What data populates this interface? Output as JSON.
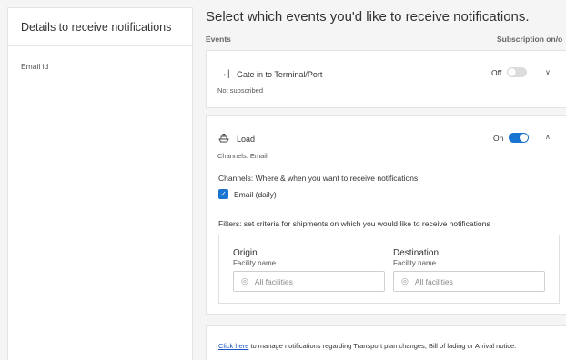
{
  "sidebar": {
    "title": "Details to receive notifications",
    "email_label": "Email id"
  },
  "main": {
    "title": "Select which events you'd like to receive notifications.",
    "col_events": "Events",
    "col_subscription": "Subscription on/o"
  },
  "events": [
    {
      "icon": "gate-in-icon",
      "name": "Gate in to Terminal/Port",
      "status": "Not subscribed",
      "toggle_label": "Off",
      "toggle_on": false,
      "expanded": false
    },
    {
      "icon": "ship-load-icon",
      "name": "Load",
      "status": "Channels: Email",
      "toggle_label": "On",
      "toggle_on": true,
      "expanded": true,
      "channels_heading": "Channels: Where & when you want to receive notifications",
      "channel_option": "Email (daily)",
      "channel_checked": true,
      "filters_heading": "Filters: set criteria for shipments on which you would like to receive notifications",
      "origin_title": "Origin",
      "origin_sub": "Facility name",
      "origin_placeholder": "All facilities",
      "destination_title": "Destination",
      "destination_sub": "Facility name",
      "destination_placeholder": "All facilities"
    }
  ],
  "footer": {
    "link_text": "Click here",
    "rest_text": " to manage notifications regarding Transport plan changes, Bill of lading or Arrival notice."
  },
  "colors": {
    "accent": "#1a75d2",
    "link": "#1a55c8"
  }
}
